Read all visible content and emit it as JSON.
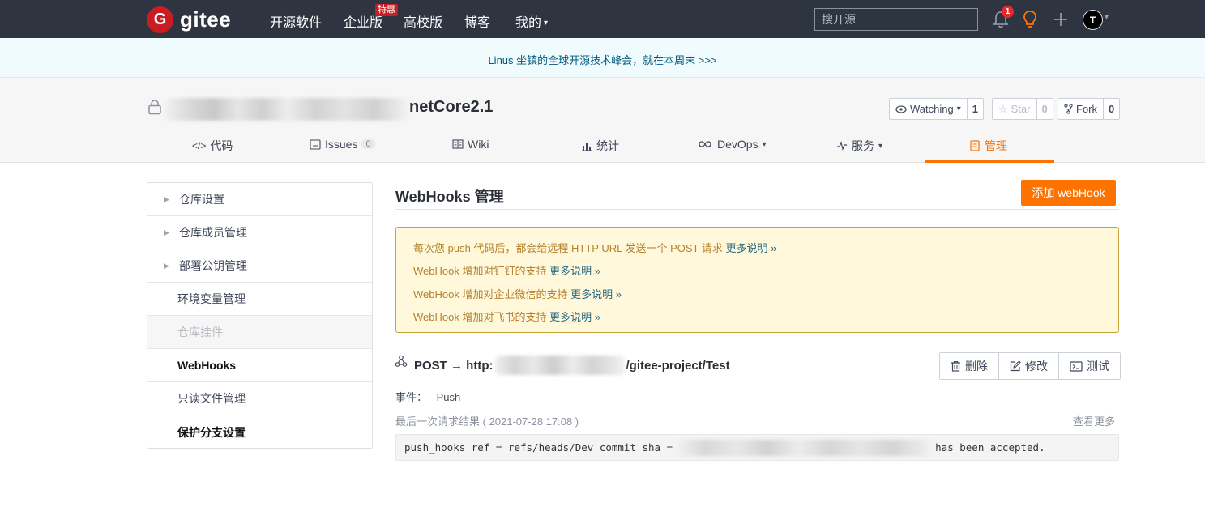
{
  "nav": {
    "logo_mark": "G",
    "logo_text": "gitee",
    "items": [
      "开源软件",
      "企业版",
      "高校版",
      "博客",
      "我的"
    ],
    "enterprise_badge": "特惠",
    "search_placeholder": "搜开源",
    "notification_count": "1",
    "avatar_letter": "T",
    "caret": "▾"
  },
  "banner": {
    "text": "Linus 坐镇的全球开源技术峰会，就在本周末 >>>"
  },
  "repo": {
    "name_suffix": "netCore2.1",
    "watch": {
      "label": "Watching",
      "count": "1"
    },
    "star": {
      "label": "Star",
      "count": "0"
    },
    "fork": {
      "label": "Fork",
      "count": "0"
    }
  },
  "tabs": {
    "code": "代码",
    "issues": "Issues",
    "issues_count": "0",
    "wiki": "Wiki",
    "stats": "统计",
    "devops": "DevOps",
    "services": "服务",
    "manage": "管理"
  },
  "sidebar": {
    "items": [
      "仓库设置",
      "仓库成员管理",
      "部署公钥管理",
      "环境变量管理",
      "仓库挂件",
      "WebHooks",
      "只读文件管理",
      "保护分支设置"
    ]
  },
  "main": {
    "title": "WebHooks 管理",
    "add_button": "添加 webHook",
    "notice": {
      "l1_text": "每次您 push 代码后，都会给远程 HTTP URL 发送一个 POST 请求",
      "l2_text": "WebHook 增加对钉钉的支持",
      "l3_text": "WebHook 增加对企业微信的支持",
      "l4_text": "WebHook 增加对飞书的支持",
      "more_link": "更多说明 »"
    },
    "hook": {
      "prefix": "POST → http:",
      "suffix": "/gitee-project/Test",
      "delete": "删除",
      "edit": "修改",
      "test": "测试",
      "events_label": "事件：",
      "events_value": "Push",
      "last_request": "最后一次请求结果 ( 2021-07-28 17:08 )",
      "view_more": "查看更多",
      "result_prefix": "push_hooks ref = refs/heads/Dev commit sha =",
      "result_suffix": "has been accepted."
    }
  }
}
